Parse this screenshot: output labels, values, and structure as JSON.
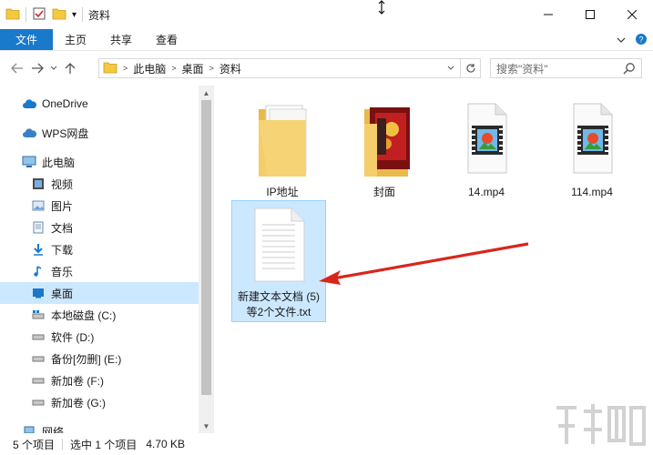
{
  "window": {
    "title": "资料",
    "qa_dropdown": "▾"
  },
  "ribbon": {
    "tabs": [
      "文件",
      "主页",
      "共享",
      "查看"
    ]
  },
  "address": {
    "crumbs": [
      "此电脑",
      "桌面",
      "资料"
    ]
  },
  "search": {
    "placeholder": "搜索\"资料\""
  },
  "nav": {
    "items": [
      {
        "label": "OneDrive",
        "icon": "cloud-icon"
      },
      {
        "label": "WPS网盘",
        "icon": "cloud-icon"
      },
      {
        "label": "此电脑",
        "icon": "computer-icon"
      },
      {
        "label": "视频",
        "icon": "video-folder-icon"
      },
      {
        "label": "图片",
        "icon": "pictures-folder-icon"
      },
      {
        "label": "文档",
        "icon": "documents-folder-icon"
      },
      {
        "label": "下载",
        "icon": "download-icon"
      },
      {
        "label": "音乐",
        "icon": "music-icon"
      },
      {
        "label": "桌面",
        "icon": "desktop-icon",
        "selected": true
      },
      {
        "label": "本地磁盘 (C:)",
        "icon": "system-drive-icon"
      },
      {
        "label": "软件 (D:)",
        "icon": "drive-icon"
      },
      {
        "label": "备份[勿删] (E:)",
        "icon": "drive-icon"
      },
      {
        "label": "新加卷 (F:)",
        "icon": "drive-icon"
      },
      {
        "label": "新加卷 (G:)",
        "icon": "drive-icon"
      },
      {
        "label": "网络",
        "icon": "network-icon"
      }
    ]
  },
  "files": [
    {
      "name": "IP地址",
      "kind": "folder"
    },
    {
      "name": "封面",
      "kind": "folder-with-images"
    },
    {
      "name": "14.mp4",
      "kind": "video"
    },
    {
      "name": "114.mp4",
      "kind": "video"
    },
    {
      "name_line1": "新建文本文档 (5)",
      "name_line2": "等2个文件.txt",
      "kind": "text",
      "selected": true
    }
  ],
  "status": {
    "count": "5 个项目",
    "selection": "选中 1 个项目",
    "size": "4.70 KB"
  },
  "colors": {
    "accent": "#1979ca",
    "selection": "#cce8ff",
    "arrow": "#d9261c"
  }
}
